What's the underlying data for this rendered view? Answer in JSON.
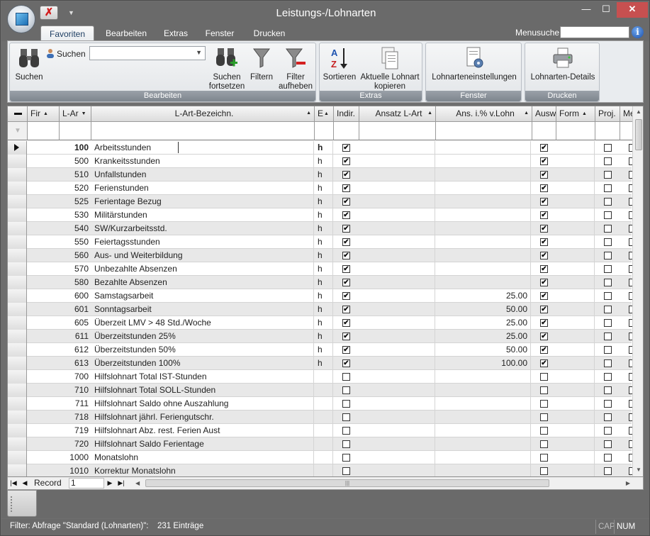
{
  "window": {
    "title": "Leistungs-/Lohnarten"
  },
  "tabs": [
    {
      "label": "Favoriten"
    },
    {
      "label": "Bearbeiten"
    },
    {
      "label": "Extras"
    },
    {
      "label": "Fenster"
    },
    {
      "label": "Drucken"
    }
  ],
  "menusuche": {
    "label": "Menusuche",
    "value": ""
  },
  "ribbon": {
    "suchen_small_label": "Suchen",
    "search_combo_value": "",
    "buttons": {
      "suchen": "Suchen",
      "suchen_fortsetzen": "Suchen\nfortsetzen",
      "filtern": "Filtern",
      "filter_aufheben": "Filter\naufheben",
      "sortieren": "Sortieren",
      "aktuelle_lohnart": "Aktuelle Lohnart\nkopieren",
      "lohnarteneinstellungen": "Lohnarteneinstellungen",
      "lohnarten_details": "Lohnarten-Details"
    },
    "groups": {
      "bearbeiten": "Bearbeiten",
      "extras": "Extras",
      "fenster": "Fenster",
      "drucken": "Drucken"
    }
  },
  "grid": {
    "columns": {
      "fir": "Fir",
      "lart": "L-Ar",
      "bezeichnung": "L-Art-Bezeichn.",
      "e": "E",
      "indir": "Indir.",
      "ansatz": "Ansatz L-Art",
      "ans_pct": "Ans. i.% v.Lohn",
      "ausw": "Ausw",
      "form": "Form",
      "proj": "Proj.",
      "more": "Me"
    },
    "rows": [
      {
        "num": "100",
        "name": "Arbeitsstunden",
        "unit": "h",
        "indir": true,
        "ans": "",
        "ausw": true,
        "proj": false
      },
      {
        "num": "500",
        "name": "Krankeitsstunden",
        "unit": "h",
        "indir": true,
        "ans": "",
        "ausw": true,
        "proj": false
      },
      {
        "num": "510",
        "name": "Unfallstunden",
        "unit": "h",
        "indir": true,
        "ans": "",
        "ausw": true,
        "proj": false
      },
      {
        "num": "520",
        "name": "Ferienstunden",
        "unit": "h",
        "indir": true,
        "ans": "",
        "ausw": true,
        "proj": false
      },
      {
        "num": "525",
        "name": "Ferientage Bezug",
        "unit": "h",
        "indir": true,
        "ans": "",
        "ausw": true,
        "proj": false
      },
      {
        "num": "530",
        "name": "Militärstunden",
        "unit": "h",
        "indir": true,
        "ans": "",
        "ausw": true,
        "proj": false
      },
      {
        "num": "540",
        "name": "SW/Kurzarbeitsstd.",
        "unit": "h",
        "indir": true,
        "ans": "",
        "ausw": true,
        "proj": false
      },
      {
        "num": "550",
        "name": "Feiertagsstunden",
        "unit": "h",
        "indir": true,
        "ans": "",
        "ausw": true,
        "proj": false
      },
      {
        "num": "560",
        "name": "Aus- und Weiterbildung",
        "unit": "h",
        "indir": true,
        "ans": "",
        "ausw": true,
        "proj": false
      },
      {
        "num": "570",
        "name": "Unbezahlte Absenzen",
        "unit": "h",
        "indir": true,
        "ans": "",
        "ausw": true,
        "proj": false
      },
      {
        "num": "580",
        "name": "Bezahlte Absenzen",
        "unit": "h",
        "indir": true,
        "ans": "",
        "ausw": true,
        "proj": false
      },
      {
        "num": "600",
        "name": "Samstagsarbeit",
        "unit": "h",
        "indir": true,
        "ans": "25.00",
        "ausw": true,
        "proj": false
      },
      {
        "num": "601",
        "name": "Sonntagsarbeit",
        "unit": "h",
        "indir": true,
        "ans": "50.00",
        "ausw": true,
        "proj": false
      },
      {
        "num": "605",
        "name": "Überzeit LMV > 48 Std./Woche",
        "unit": "h",
        "indir": true,
        "ans": "25.00",
        "ausw": true,
        "proj": false
      },
      {
        "num": "611",
        "name": "Überzeitstunden 25%",
        "unit": "h",
        "indir": true,
        "ans": "25.00",
        "ausw": true,
        "proj": false
      },
      {
        "num": "612",
        "name": "Überzeitstunden 50%",
        "unit": "h",
        "indir": true,
        "ans": "50.00",
        "ausw": true,
        "proj": false
      },
      {
        "num": "613",
        "name": "Überzeitstunden 100%",
        "unit": "h",
        "indir": true,
        "ans": "100.00",
        "ausw": true,
        "proj": false
      },
      {
        "num": "700",
        "name": "Hilfslohnart Total IST-Stunden",
        "unit": "",
        "indir": false,
        "ans": "",
        "ausw": false,
        "proj": false
      },
      {
        "num": "710",
        "name": "Hilfslohnart Total SOLL-Stunden",
        "unit": "",
        "indir": false,
        "ans": "",
        "ausw": false,
        "proj": false
      },
      {
        "num": "711",
        "name": "Hilfslohnart Saldo ohne Auszahlung",
        "unit": "",
        "indir": false,
        "ans": "",
        "ausw": false,
        "proj": false
      },
      {
        "num": "718",
        "name": "Hilfslohnart jährl. Feriengutschr.",
        "unit": "",
        "indir": false,
        "ans": "",
        "ausw": false,
        "proj": false
      },
      {
        "num": "719",
        "name": "Hilfslohnart Abz. rest. Ferien Aust",
        "unit": "",
        "indir": false,
        "ans": "",
        "ausw": false,
        "proj": false
      },
      {
        "num": "720",
        "name": "Hilfslohnart Saldo Ferientage",
        "unit": "",
        "indir": false,
        "ans": "",
        "ausw": false,
        "proj": false
      },
      {
        "num": "1000",
        "name": "Monatslohn",
        "unit": "",
        "indir": false,
        "ans": "",
        "ausw": false,
        "proj": false
      },
      {
        "num": "1010",
        "name": "Korrektur Monatslohn",
        "unit": "",
        "indir": false,
        "ans": "",
        "ausw": false,
        "proj": false
      }
    ]
  },
  "navigator": {
    "label": "Record",
    "value": "1"
  },
  "status": {
    "filter": "Filter: Abfrage \"Standard (Lohnarten)\":",
    "count": "231 Einträge",
    "cap": "CAP",
    "num": "NUM"
  }
}
